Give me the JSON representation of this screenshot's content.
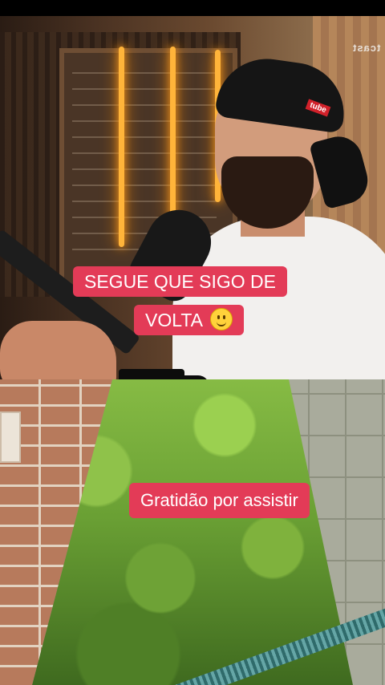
{
  "captions": {
    "top_line1": "SEGUE QUE SIGO DE",
    "top_line2": "VOLTA",
    "bottom": "Gratidão por assistir"
  },
  "watermark": "tcast",
  "cap_logo": "tube",
  "emoji": "slightly-smiling-face",
  "colors": {
    "caption_bg": "#e33b57",
    "caption_text": "#ffffff"
  }
}
